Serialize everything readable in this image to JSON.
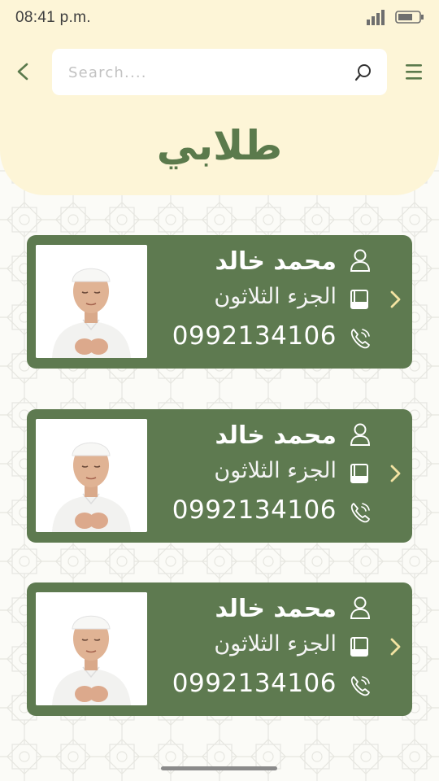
{
  "status_bar": {
    "time": "08:41 p.m."
  },
  "search": {
    "placeholder": "Search...."
  },
  "title": "طلابي",
  "colors": {
    "header_bg": "#fdf5d7",
    "card_bg": "#5e7a50",
    "accent": "#5b7a4c",
    "chevron": "#f3e3a2"
  },
  "students": [
    {
      "name": "محمد خالد",
      "part": "الجزء الثلاثون",
      "phone": "0992134106"
    },
    {
      "name": "محمد خالد",
      "part": "الجزء الثلاثون",
      "phone": "0992134106"
    },
    {
      "name": "محمد خالد",
      "part": "الجزء الثلاثون",
      "phone": "0992134106"
    }
  ]
}
